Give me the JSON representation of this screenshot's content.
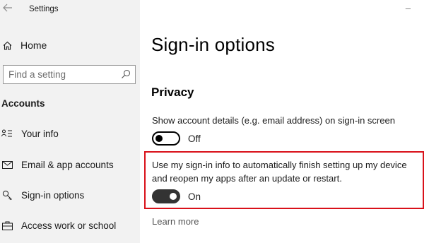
{
  "window": {
    "title": "Settings",
    "minimize_glyph": "–"
  },
  "sidebar": {
    "back_icon": "back-arrow-icon",
    "home": {
      "label": "Home",
      "icon": "home-icon"
    },
    "search": {
      "placeholder": "Find a setting",
      "icon": "search-icon"
    },
    "section": "Accounts",
    "items": [
      {
        "label": "Your info",
        "icon": "person-card-icon"
      },
      {
        "label": "Email & app accounts",
        "icon": "envelope-icon"
      },
      {
        "label": "Sign-in options",
        "icon": "key-icon"
      },
      {
        "label": "Access work or school",
        "icon": "briefcase-icon"
      }
    ]
  },
  "main": {
    "title": "Sign-in options",
    "privacy": {
      "heading": "Privacy",
      "settings": [
        {
          "label": "Show account details (e.g. email address) on sign-in screen",
          "state": "Off",
          "on": false
        },
        {
          "label_line1": "Use my sign-in info to automatically finish setting up my device",
          "label_line2": "and reopen my apps after an update or restart.",
          "state": "On",
          "on": true,
          "highlighted": true
        }
      ],
      "learn_more": "Learn more"
    }
  },
  "colors": {
    "sidebar_bg": "#f2f2f2",
    "highlight_border": "#d9111a",
    "toggle_on": "#333333"
  }
}
